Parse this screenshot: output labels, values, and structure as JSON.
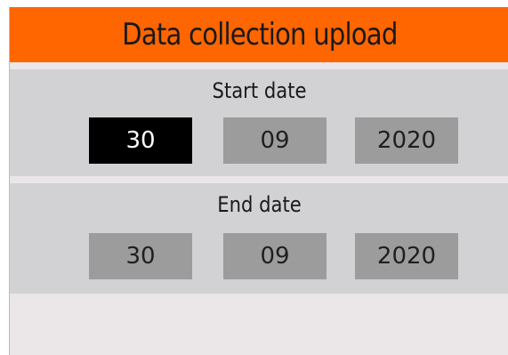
{
  "title": "Data collection upload",
  "start_date": {
    "label": "Start date",
    "day": "30",
    "month": "09",
    "year": "2020",
    "selected_field": "day"
  },
  "end_date": {
    "label": "End date",
    "day": "30",
    "month": "09",
    "year": "2020"
  },
  "colors": {
    "header": "#ff6600",
    "panel": "#d2d1d3",
    "field": "#9d9c9d",
    "selected_field": "#000000",
    "background": "#ebe7e8"
  }
}
